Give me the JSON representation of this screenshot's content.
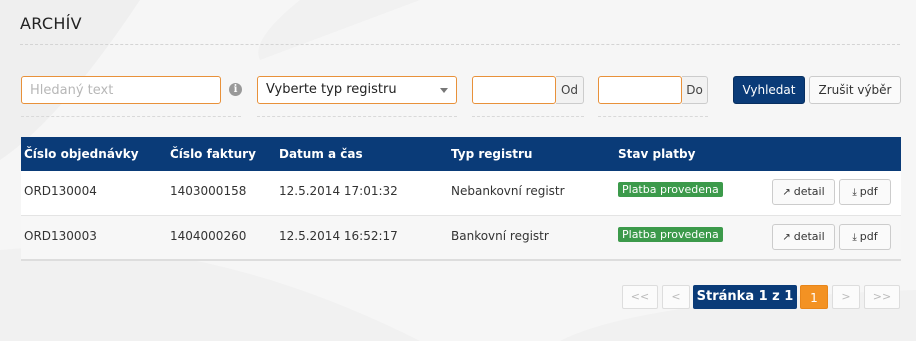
{
  "page": {
    "title": "ARCHÍV"
  },
  "filters": {
    "search_placeholder": "Hledaný text",
    "info_icon": "info-circle-icon",
    "register_type_value": "Vyberte typ registru",
    "date_from_label": "Od",
    "date_to_label": "Do",
    "search_button": "Vyhledat",
    "clear_button": "Zrušit výběr"
  },
  "table": {
    "columns": [
      "Číslo objednávky",
      "Číslo faktury",
      "Datum a čas",
      "Typ registru",
      "Stav platby"
    ],
    "rows": [
      {
        "order": "ORD130004",
        "invoice": "1403000158",
        "datetime": "12.5.2014 17:01:32",
        "type": "Nebankovní registr",
        "status": "Platba provedena",
        "detail": "detail",
        "pdf": "pdf"
      },
      {
        "order": "ORD130003",
        "invoice": "1404000260",
        "datetime": "12.5.2014 16:52:17",
        "type": "Bankovní registr",
        "status": "Platba provedena",
        "detail": "detail",
        "pdf": "pdf"
      }
    ]
  },
  "pagination": {
    "first": "<<",
    "prev": "<",
    "info": "Stránka 1 z 1",
    "current": "1",
    "next": ">",
    "last": ">>"
  },
  "colors": {
    "primary": "#0a3b78",
    "accent": "#f39223",
    "success": "#3c9a4b",
    "input_border": "#e8913a"
  }
}
